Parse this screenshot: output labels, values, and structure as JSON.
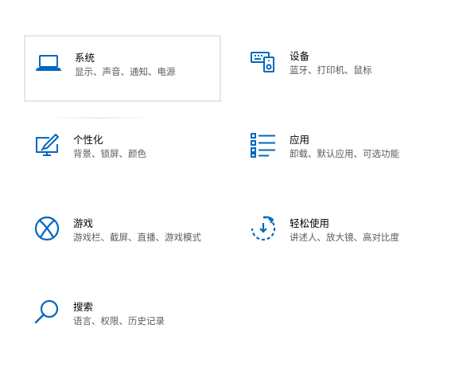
{
  "colors": {
    "accent": "#0067c0",
    "title_text": "#000000",
    "desc_text": "#5c5c5c",
    "focus_border": "#e6e6e6"
  },
  "tiles": [
    {
      "icon": "laptop-icon",
      "title": "系统",
      "desc": "显示、声音、通知、电源"
    },
    {
      "icon": "devices-icon",
      "title": "设备",
      "desc": "蓝牙、打印机、鼠标"
    },
    {
      "icon": "personalization-icon",
      "title": "个性化",
      "desc": "背景、锁屏、颜色"
    },
    {
      "icon": "apps-icon",
      "title": "应用",
      "desc": "卸载、默认应用、可选功能"
    },
    {
      "icon": "xbox-icon",
      "title": "游戏",
      "desc": "游戏栏、截屏、直播、游戏模式"
    },
    {
      "icon": "ease-of-access-icon",
      "title": "轻松使用",
      "desc": "讲述人、放大镜、高对比度"
    },
    {
      "icon": "search-icon",
      "title": "搜索",
      "desc": "语言、权限、历史记录"
    }
  ]
}
